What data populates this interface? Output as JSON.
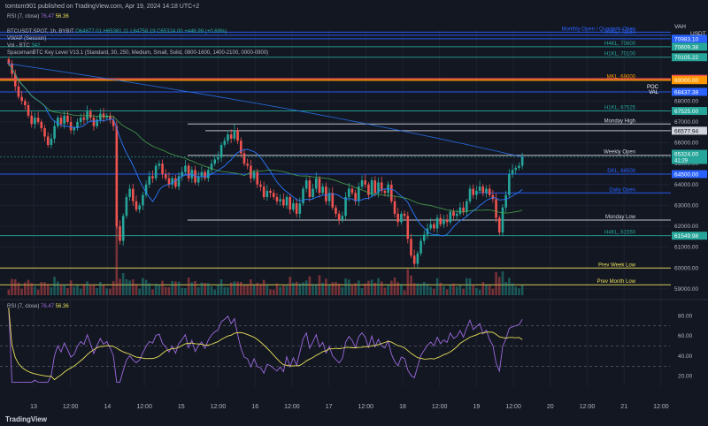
{
  "header": {
    "published": "tomtom901 published on TradingView.com, Apr 19, 2024 14:18 UTC+2",
    "top_indicator": {
      "name": "RSI (7, close)",
      "v1": "76.47",
      "v2": "56.36"
    }
  },
  "legend": {
    "symbol": "BTCUSDT.SPOT, 1h, BYBIT",
    "ohlc": "O64877.01 H65361.11 L64758.19 C65324.00 +446.99 (+0.69%)",
    "vwap": "VWAP (Session)",
    "vol": "Vol - BTC",
    "vol_value": "342",
    "spaceman": "SpacemanBTC Key Level V13.1 (Standard, 30, 250, Medium, Small, Solid, 0800-1600, 1400-2100, 0000-0900)"
  },
  "rsi_legend": {
    "name": "RSI (7, close)",
    "v1": "76.47",
    "v2": "56.36"
  },
  "footer": {
    "logo": "TradingView"
  },
  "price_axis": {
    "currency": "USDT",
    "vah": "VAH"
  },
  "colors": {
    "bg": "#131722",
    "up": "#26a69a",
    "down": "#ef5350",
    "grid": "#1e2230",
    "blue": "#2962ff",
    "orange": "#ff9800",
    "red": "#ef5350",
    "green": "#26a69a",
    "rsi": "#9c6ade",
    "rsi_ma": "#e9e05a",
    "text": "#b2b5be",
    "vwap": "#2979ff",
    "sma": "#4caf50"
  },
  "chart_data": {
    "type": "candlestick",
    "symbol": "BTCUSDT.SPOT",
    "interval": "1h",
    "ylim": [
      58700,
      71400
    ],
    "y_ticks": [
      59000,
      60000,
      61000,
      62000,
      63000,
      64000,
      65000,
      66000,
      67000,
      68000
    ],
    "x_ticks": [
      "13",
      "12:00",
      "14",
      "12:00",
      "15",
      "12:00",
      "16",
      "12:00",
      "17",
      "12:00",
      "18",
      "12:00",
      "19",
      "12:00",
      "20",
      "12:00",
      "21",
      "12:00"
    ],
    "closes": [
      69800,
      69300,
      68700,
      68200,
      68000,
      67800,
      67300,
      66900,
      67200,
      67000,
      66700,
      66300,
      65900,
      66200,
      66800,
      67200,
      66900,
      67300,
      67000,
      66600,
      66700,
      67000,
      67200,
      67100,
      67500,
      67200,
      66800,
      67100,
      67400,
      67200,
      67300,
      67100,
      66800,
      62000,
      61300,
      62500,
      63400,
      63800,
      63200,
      62800,
      63000,
      63500,
      64000,
      64400,
      64300,
      64900,
      65000,
      64500,
      64300,
      64000,
      64300,
      63900,
      64400,
      64600,
      64900,
      64300,
      64700,
      64100,
      64400,
      64600,
      64300,
      64700,
      65000,
      65200,
      65300,
      65900,
      66100,
      66400,
      66200,
      66600,
      66100,
      65500,
      65000,
      64900,
      64300,
      64600,
      64000,
      63900,
      63400,
      63700,
      63600,
      63400,
      63200,
      63300,
      63000,
      63400,
      62800,
      63100,
      62600,
      63100,
      63800,
      64200,
      63400,
      63800,
      64300,
      63600,
      63900,
      63200,
      63600,
      62900,
      62600,
      62300,
      62500,
      63400,
      63800,
      63600,
      63200,
      63900,
      64200,
      64000,
      63500,
      64200,
      63600,
      64100,
      63700,
      63600,
      64000,
      63200,
      62600,
      62200,
      62600,
      62500,
      61400,
      60600,
      60200,
      60700,
      61300,
      61600,
      61900,
      62100,
      61900,
      62400,
      62100,
      62300,
      62200,
      62700,
      62500,
      62600,
      62900,
      62700,
      63200,
      63800,
      63500,
      63700,
      63900,
      63600,
      63800,
      63500,
      63300,
      62400,
      61700,
      62900,
      63500,
      64500,
      64700,
      64800,
      64900,
      65324
    ],
    "key_levels": [
      {
        "label": "Monthly Open / Quarterly Open",
        "price": 71300,
        "value_label": "",
        "color": "#2962ff"
      },
      {
        "label": "H4KL, 71150",
        "price": 71150,
        "value_label": "",
        "color": "#2962ff"
      },
      {
        "label": "",
        "price": 70983.1,
        "value_label": "70983.10",
        "color": "#2962ff"
      },
      {
        "label": "H4KL, 70600",
        "price": 70600,
        "value_label": "70609.38",
        "color": "#26a69a"
      },
      {
        "label": "H1KL, 70100",
        "price": 70100,
        "value_label": "70105.22",
        "color": "#26a69a"
      },
      {
        "label": "",
        "price": 69064.82,
        "value_label": "69064.82",
        "color": "#ef5350"
      },
      {
        "label": "MKL, 69000",
        "price": 69000,
        "value_label": "69000.00",
        "color": "#ff9800"
      },
      {
        "label": "",
        "price": 68437.38,
        "value_label": "68437.38",
        "color": "#2962ff"
      },
      {
        "label": "H1KL, 67525",
        "price": 67525,
        "value_label": "67525.00",
        "color": "#26a69a"
      },
      {
        "label": "Monday High",
        "price": 66900,
        "value_label": "",
        "color": "#d1d4dc"
      },
      {
        "label": "",
        "price": 66577.94,
        "value_label": "66577.94",
        "color": "#d1d4dc"
      },
      {
        "label": "Weekly Open",
        "price": 65400,
        "value_label": "",
        "color": "#d1d4dc"
      },
      {
        "label": "DKL, 64500",
        "price": 64500,
        "value_label": "64500.00",
        "color": "#2962ff"
      },
      {
        "label": "Daily Open",
        "price": 63600,
        "value_label": "",
        "color": "#2962ff"
      },
      {
        "label": "Monday Low",
        "price": 62300,
        "value_label": "",
        "color": "#d1d4dc"
      },
      {
        "label": "H4KL, 61550",
        "price": 61550,
        "value_label": "61549.98",
        "color": "#26a69a"
      },
      {
        "label": "Prev Week Low",
        "price": 60000,
        "value_label": "",
        "color": "#e9e05a"
      },
      {
        "label": "Prev Month Low",
        "price": 59200,
        "value_label": "",
        "color": "#e9e05a"
      }
    ],
    "current_price": {
      "price": 65324,
      "value_label": "65324.00",
      "countdown": "41:29"
    },
    "axis_labels": {
      "poc": "POC",
      "val": "VAL"
    },
    "rsi": {
      "ylim": [
        10,
        90
      ],
      "y_ticks": [
        20,
        40,
        60,
        80
      ],
      "bands": [
        30,
        50,
        70
      ],
      "last": 76.47,
      "ma_last": 56.36
    }
  }
}
